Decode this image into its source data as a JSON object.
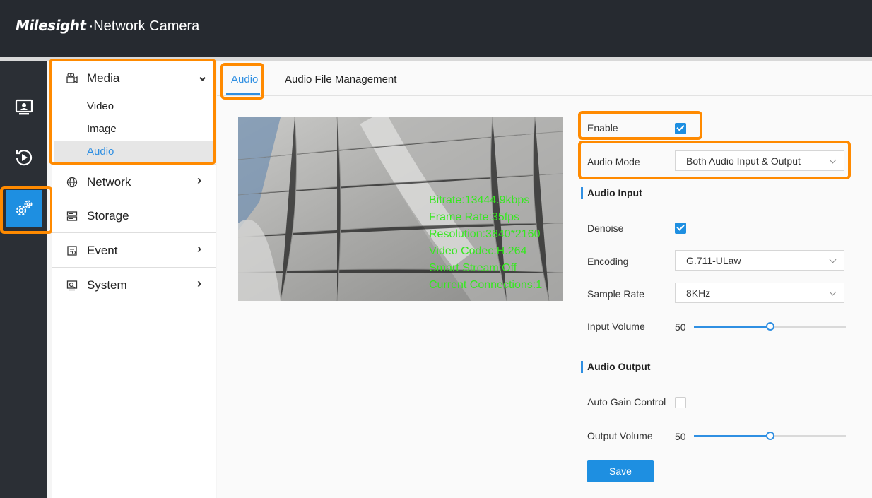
{
  "header": {
    "logo_text": "Milesight",
    "separator": "·",
    "product_name": "Network Camera"
  },
  "rail": [
    {
      "name": "live-view-icon",
      "active": false
    },
    {
      "name": "playback-icon",
      "active": false
    },
    {
      "name": "settings-gear-icon",
      "active": true
    }
  ],
  "menu": {
    "media": {
      "label": "Media",
      "chevron": "⌄"
    },
    "media_items": [
      "Video",
      "Image",
      "Audio"
    ],
    "active_item": "Audio",
    "network": {
      "label": "Network",
      "chevron": "›"
    },
    "storage": {
      "label": "Storage"
    },
    "event": {
      "label": "Event",
      "chevron": "›"
    },
    "system": {
      "label": "System",
      "chevron": "›"
    }
  },
  "tabs": [
    "Audio",
    "Audio File Management"
  ],
  "active_tab": "Audio",
  "video_overlay": [
    "Bitrate:13444.9kbps",
    "Frame Rate:35fps",
    "Resolution:3840*2160",
    "Video Codec:H.264",
    "Smart Stream:Off",
    "Current Connections:1"
  ],
  "form": {
    "enable": {
      "label": "Enable",
      "checked": true
    },
    "audio_mode": {
      "label": "Audio Mode",
      "value": "Both Audio Input & Output"
    },
    "audio_input": {
      "title": "Audio Input",
      "denoise": {
        "label": "Denoise",
        "checked": true
      },
      "encoding": {
        "label": "Encoding",
        "value": "G.711-ULaw"
      },
      "sample_rate": {
        "label": "Sample Rate",
        "value": "8KHz"
      },
      "input_volume": {
        "label": "Input Volume",
        "value": "50",
        "level": 0.5
      }
    },
    "audio_output": {
      "title": "Audio Output",
      "agc": {
        "label": "Auto Gain Control",
        "checked": false
      },
      "output_volume": {
        "label": "Output Volume",
        "value": "50",
        "level": 0.5
      }
    },
    "save_label": "Save"
  },
  "colors": {
    "accent": "#1e8fe1",
    "highlight": "#ff8a00",
    "overlay_text": "#35e81f",
    "header_bg": "#262a30"
  }
}
